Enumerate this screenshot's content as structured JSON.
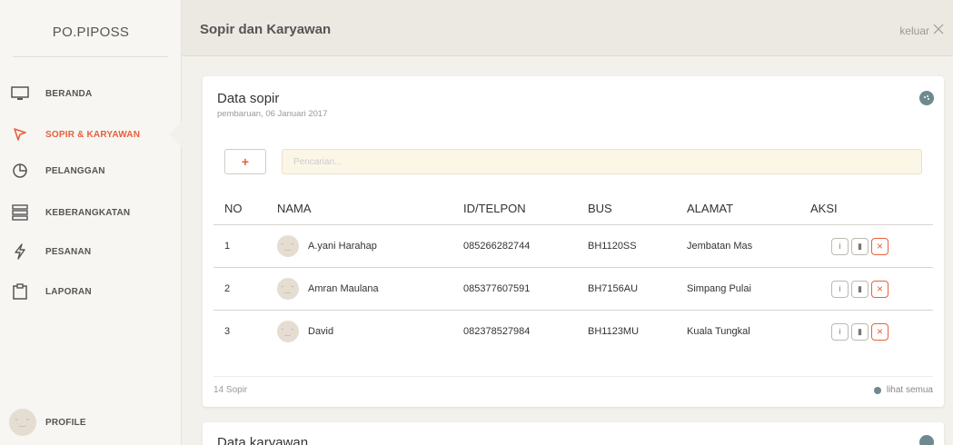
{
  "sidebar": {
    "brand": "PO.PIPOSS",
    "items": [
      {
        "label": "BERANDA",
        "icon": "monitor-icon"
      },
      {
        "label": "SOPIR & KARYAWAN",
        "icon": "send-icon",
        "active": true
      },
      {
        "label": "PELANGGAN",
        "icon": "pie-chart-icon"
      },
      {
        "label": "KEBERANGKATAN",
        "icon": "server-list-icon"
      },
      {
        "label": "PESANAN",
        "icon": "lightning-icon"
      },
      {
        "label": "LAPORAN",
        "icon": "clipboard-icon"
      }
    ],
    "profile_label": "PROFILE"
  },
  "header": {
    "title": "Sopir dan Karyawan",
    "logout_label": "keluar"
  },
  "card": {
    "title": "Data sopir",
    "subtitle": "pembaruan, 06 Januari 2017",
    "add_label": "+",
    "search_placeholder": "Pencarian...",
    "columns": [
      "NO",
      "NAMA",
      "ID/TELPON",
      "BUS",
      "ALAMAT",
      "AKSI"
    ],
    "rows": [
      {
        "no": "1",
        "name": "A.yani Harahap",
        "phone": "085266282744",
        "bus": "BH1120SS",
        "address": "Jembatan Mas"
      },
      {
        "no": "2",
        "name": "Amran Maulana",
        "phone": "085377607591",
        "bus": "BH7156AU",
        "address": "Simpang Pulai"
      },
      {
        "no": "3",
        "name": "David",
        "phone": "082378527984",
        "bus": "BH1123MU",
        "address": "Kuala Tungkal"
      }
    ],
    "count_label": "14 Sopir",
    "see_all_label": "lihat semua"
  },
  "card2": {
    "title": "Data karyawan"
  },
  "colors": {
    "accent": "#e8603c",
    "teal": "#6e8a8e",
    "search_bg": "#fbf6e6"
  }
}
